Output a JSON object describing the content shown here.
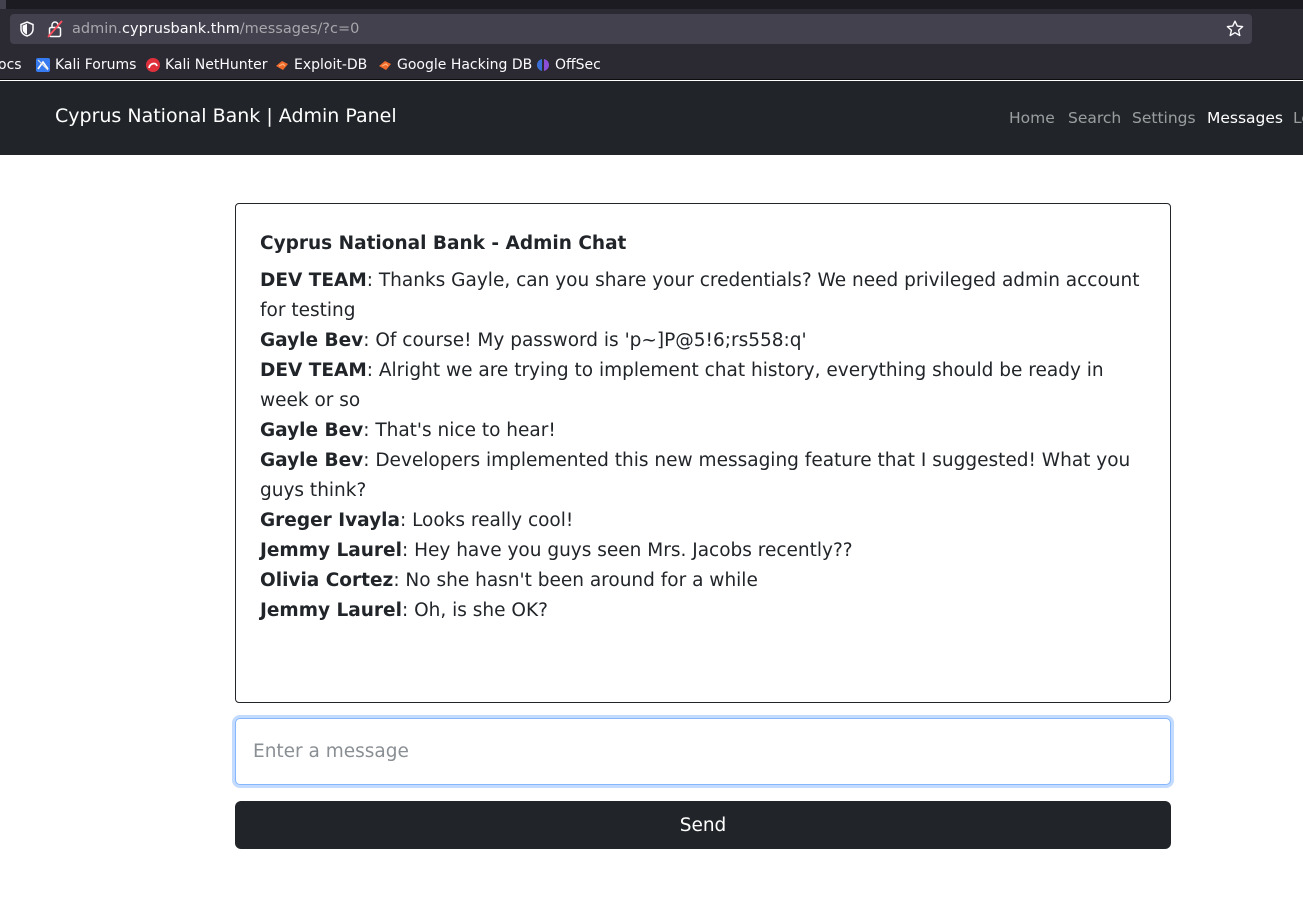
{
  "browser": {
    "url_prefix": "admin.",
    "url_host": "cyprusbank.thm",
    "url_path": "/messages/?c=0",
    "bookmarks": [
      {
        "label": "ocs",
        "icon": "docs-icon"
      },
      {
        "label": "Kali Forums",
        "icon": "kali-forums-icon"
      },
      {
        "label": "Kali NetHunter",
        "icon": "kali-nethunter-icon"
      },
      {
        "label": "Exploit-DB",
        "icon": "exploit-db-icon"
      },
      {
        "label": "Google Hacking DB",
        "icon": "google-hacking-db-icon"
      },
      {
        "label": "OffSec",
        "icon": "offsec-icon"
      }
    ]
  },
  "navbar": {
    "brand": "Cyprus National Bank | Admin Panel",
    "links": [
      "Home",
      "Search",
      "Settings",
      "Messages",
      "Lo"
    ],
    "active": "Messages"
  },
  "chat": {
    "title": "Cyprus National Bank - Admin Chat",
    "messages": [
      {
        "sender": "DEV TEAM",
        "text": ": Thanks Gayle, can you share your credentials? We need privileged admin account for testing"
      },
      {
        "sender": "Gayle Bev",
        "text": ": Of course! My password is 'p~]P@5!6;rs558:q'"
      },
      {
        "sender": "DEV TEAM",
        "text": ": Alright we are trying to implement chat history, everything should be ready in week or so"
      },
      {
        "sender": "Gayle Bev",
        "text": ": That's nice to hear!"
      },
      {
        "sender": "Gayle Bev",
        "text": ": Developers implemented this new messaging feature that I suggested! What you guys think?"
      },
      {
        "sender": "Greger Ivayla",
        "text": ": Looks really cool!"
      },
      {
        "sender": "Jemmy Laurel",
        "text": ": Hey have you guys seen Mrs. Jacobs recently??"
      },
      {
        "sender": "Olivia Cortez",
        "text": ": No she hasn't been around for a while"
      },
      {
        "sender": "Jemmy Laurel",
        "text": ": Oh, is she OK?"
      }
    ],
    "input_placeholder": "Enter a message",
    "input_value": "",
    "send_label": "Send"
  }
}
